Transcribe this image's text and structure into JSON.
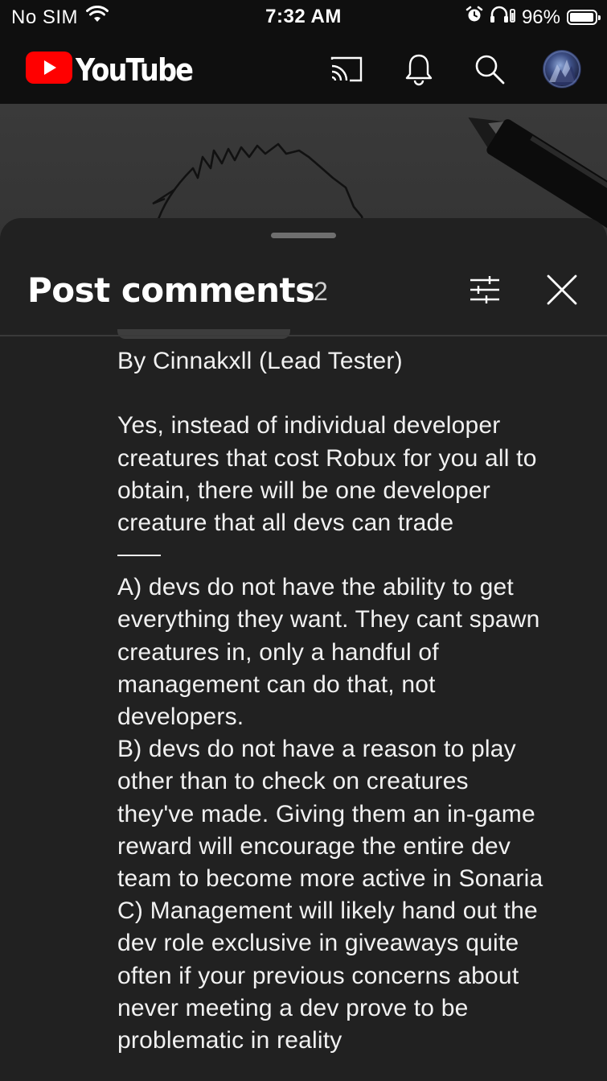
{
  "status_bar": {
    "carrier": "No SIM",
    "time": "7:32 AM",
    "battery": "96%",
    "battery_level": 0.96,
    "icons": [
      "wifi-icon",
      "alarm-icon",
      "headphones-icon",
      "battery-icon"
    ]
  },
  "header": {
    "logo_text": "YouTube",
    "brand_color": "#ff0000",
    "icons": [
      "cast-icon",
      "bell-icon",
      "search-icon",
      "avatar"
    ]
  },
  "sheet": {
    "title": "Post comments",
    "count": "2",
    "icons": [
      "filter-icon",
      "close-icon"
    ]
  },
  "comment": {
    "byline": "By Cinnakxll (Lead Tester)",
    "para1": [
      "Yes, instead of individual developer",
      "creatures that cost Robux for you all to",
      "obtain, there will be one developer",
      "creature that all devs can trade"
    ],
    "para2": [
      "A) devs do not have the ability to get",
      "everything they want. They cant spawn",
      "creatures in, only a handful of",
      "management can do that, not",
      "developers.",
      "B) devs do not have a reason to play",
      "other than to check on creatures",
      "they've made. Giving them an in-game",
      "reward will encourage the entire dev",
      "team to become more active in Sonaria",
      "C) Management will likely hand out the",
      "dev role exclusive in giveaways quite",
      "often if your previous concerns about",
      "never meeting a dev prove to be",
      "problematic in reality"
    ]
  }
}
